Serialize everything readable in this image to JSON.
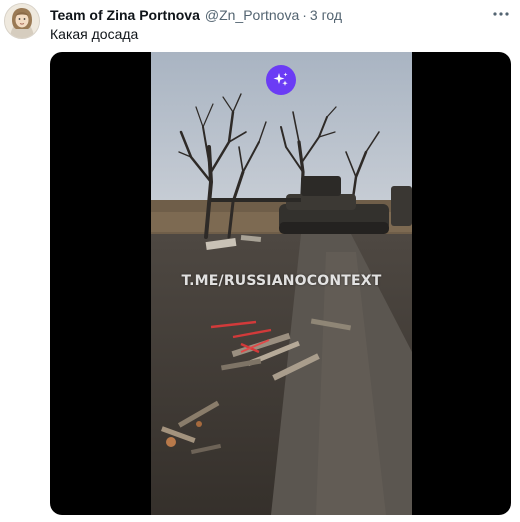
{
  "tweet": {
    "display_name": "Team of Zina Portnova",
    "handle": "@Zn_Portnova",
    "separator": "·",
    "time": "3 год",
    "text": "Какая досада",
    "more_icon": "more-horizontal-icon",
    "avatar_icon": "avatar"
  },
  "media": {
    "watermark": "T.ME/RUSSIANOCONTEXT",
    "badge_icon": "sparkle-icon",
    "badge_color": "#6b3cf5"
  },
  "colors": {
    "primary_text": "#0f1419",
    "secondary_text": "#536471",
    "media_background": "#000000"
  }
}
